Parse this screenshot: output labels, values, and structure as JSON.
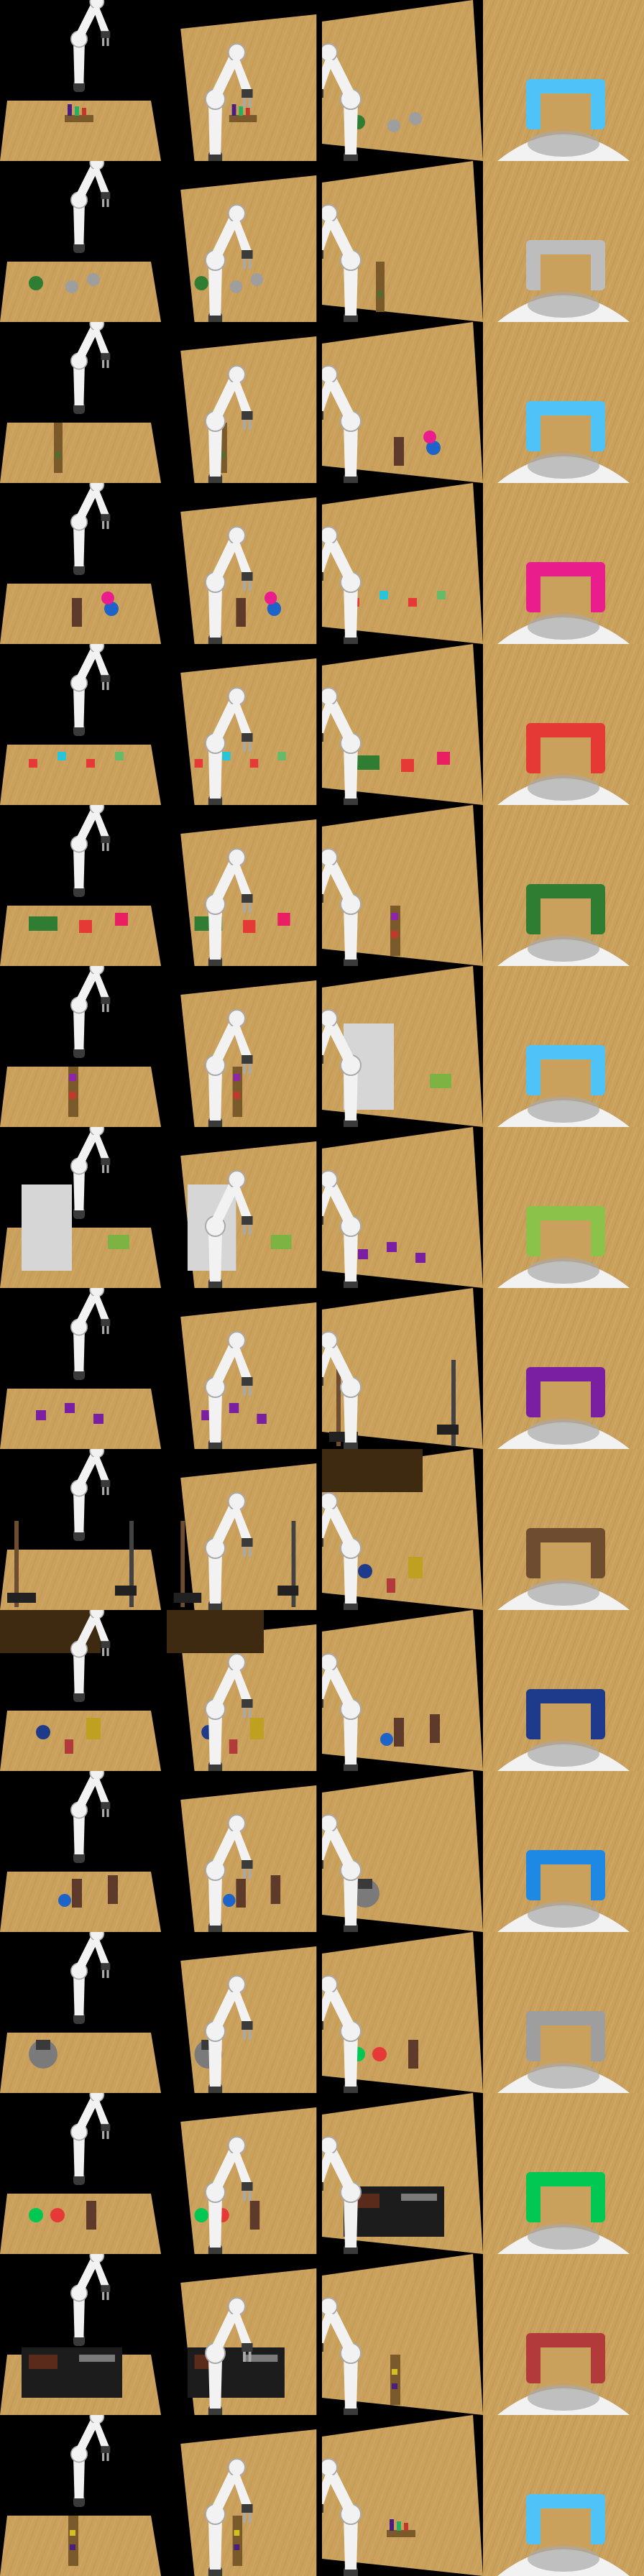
{
  "grid": {
    "columns": [
      "front-view",
      "overhead-view-left",
      "overhead-view-right",
      "wrist-camera-view"
    ],
    "rows": [
      {
        "scene": "blocks-on-plank"
      },
      {
        "scene": "cups-and-mugs"
      },
      {
        "scene": "plank-with-block"
      },
      {
        "scene": "bottles-and-caps"
      },
      {
        "scene": "scattered-cubes"
      },
      {
        "scene": "colored-pads"
      },
      {
        "scene": "plank-with-pegs"
      },
      {
        "scene": "steps-and-banknote"
      },
      {
        "scene": "purple-blocks"
      },
      {
        "scene": "stick-and-posts"
      },
      {
        "scene": "cluttered-cans"
      },
      {
        "scene": "bottles-on-table"
      },
      {
        "scene": "grey-cylinder"
      },
      {
        "scene": "green-red-bottles"
      },
      {
        "scene": "grill-and-meat"
      },
      {
        "scene": "plank-with-small-blocks"
      }
    ]
  },
  "colors": {
    "background": "#000000",
    "table": "#caa15c",
    "table_dark": "#b58a45",
    "robot": "#f2f2f2",
    "robot_shadow": "#a9a9a9",
    "robot_joint": "#3a3a3a",
    "gripper_frame": "#4fc3f7"
  }
}
